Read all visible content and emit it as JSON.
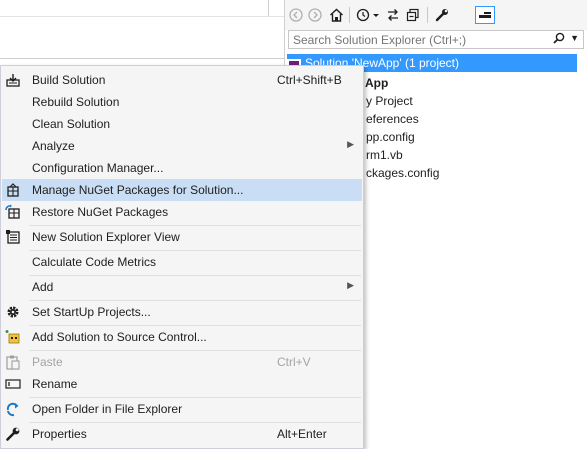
{
  "solution_explorer": {
    "search_placeholder": "Search Solution Explorer (Ctrl+;)",
    "tree": [
      {
        "label": "Solution 'NewApp' (1 project)",
        "selected": true
      },
      {
        "label": "App"
      },
      {
        "label": "y Project"
      },
      {
        "label": "eferences"
      },
      {
        "label": "pp.config"
      },
      {
        "label": "rm1.vb"
      },
      {
        "label": "ckages.config"
      }
    ]
  },
  "menu": {
    "items": [
      {
        "label": "Build Solution",
        "shortcut": "Ctrl+Shift+B",
        "icon": "build-icon"
      },
      {
        "label": "Rebuild Solution"
      },
      {
        "label": "Clean Solution"
      },
      {
        "label": "Analyze",
        "submenu": true
      },
      {
        "label": "Configuration Manager..."
      },
      {
        "label": "Manage NuGet Packages for Solution...",
        "icon": "nuget-icon",
        "highlighted": true
      },
      {
        "label": "Restore NuGet Packages",
        "icon": "restore-nuget-icon"
      },
      {
        "label": "New Solution Explorer View",
        "icon": "new-view-icon"
      },
      {
        "label": "Calculate Code Metrics"
      },
      {
        "label": "Add",
        "submenu": true
      },
      {
        "label": "Set StartUp Projects...",
        "icon": "gear-icon"
      },
      {
        "label": "Add Solution to Source Control...",
        "icon": "source-control-icon"
      },
      {
        "label": "Paste",
        "shortcut": "Ctrl+V",
        "icon": "paste-icon",
        "disabled": true
      },
      {
        "label": "Rename",
        "icon": "rename-icon"
      },
      {
        "label": "Open Folder in File Explorer",
        "icon": "open-folder-icon"
      },
      {
        "label": "Properties",
        "shortcut": "Alt+Enter",
        "icon": "wrench-icon"
      }
    ]
  },
  "colors": {
    "selection": "#3399ff",
    "menu_highlight": "#c9def5",
    "menu_bg": "#f5f5f5"
  }
}
